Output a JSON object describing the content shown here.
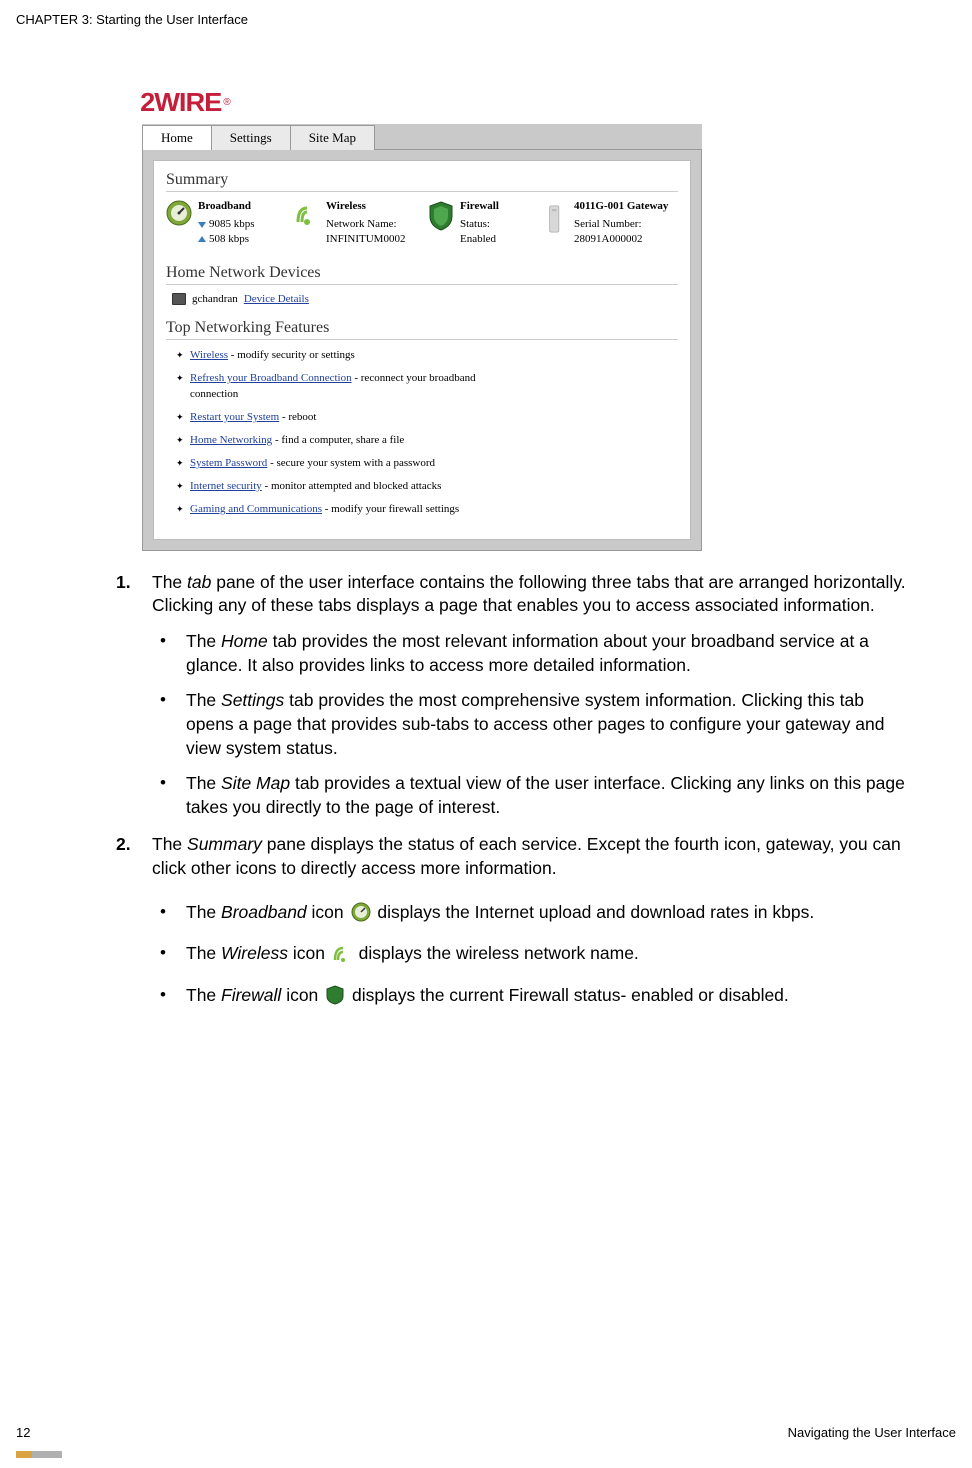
{
  "chapter": "CHAPTER 3: Starting the User Interface",
  "screenshot": {
    "logo": "2WIRE",
    "logo_reg": "®",
    "tabs": [
      "Home",
      "Settings",
      "Site Map"
    ],
    "summary_title": "Summary",
    "broadband": {
      "label": "Broadband",
      "down": "9085 kbps",
      "up": "508 kbps"
    },
    "wireless": {
      "label": "Wireless",
      "nn_label": "Network Name:",
      "nn_value": "INFINITUM0002"
    },
    "firewall": {
      "label": "Firewall",
      "status_label": "Status:",
      "status_value": "Enabled"
    },
    "gateway": {
      "label": "4011G-001 Gateway",
      "sn_label": "Serial Number:",
      "sn_value": "28091A000002"
    },
    "home_devices_title": "Home Network Devices",
    "device_name": "gchandran",
    "device_details": "Device Details",
    "top_features_title": "Top Networking Features",
    "features": [
      {
        "link": "Wireless",
        "rest": " - modify security or settings"
      },
      {
        "link": "Refresh your Broadband Connection",
        "rest": " - reconnect your broadband connection"
      },
      {
        "link": "Restart your System",
        "rest": " - reboot"
      },
      {
        "link": "Home Networking",
        "rest": " - find a computer, share a file"
      },
      {
        "link": "System Password",
        "rest": " - secure your system with a password"
      },
      {
        "link": "Internet security",
        "rest": " - monitor attempted and blocked attacks"
      },
      {
        "link": "Gaming and Communications",
        "rest": " - modify your firewall settings"
      }
    ]
  },
  "body": {
    "item1_intro": "The ",
    "item1_tab_word": "tab",
    "item1_rest": " pane of the user interface contains the following three tabs that are arranged horizontally. Clicking any of these tabs displays a page that enables you to access associated information.",
    "bullets1": [
      {
        "pre": "The ",
        "it": "Home",
        "post": " tab provides the most relevant information about your broadband service at a glance. It also provides links to access more detailed information."
      },
      {
        "pre": "The ",
        "it": "Settings",
        "post": " tab provides the most comprehensive system information. Clicking this tab opens a page that provides sub-tabs to access other pages to configure your gateway and view system status."
      },
      {
        "pre": "The ",
        "it": "Site Map",
        "post": " tab provides a textual view of the user interface. Clicking any links on this page takes you directly to the page of interest."
      }
    ],
    "item2_intro": "The ",
    "item2_summary_word": "Summary",
    "item2_rest": " pane displays the status of each service. Except the fourth icon, gateway, you can click other icons to directly access more information.",
    "bullets2": [
      {
        "pre": "The ",
        "it": "Broadband",
        "mid": " icon ",
        "post": " displays the Internet upload and download rates in kbps."
      },
      {
        "pre": "The ",
        "it": "Wireless",
        "mid": " icon ",
        "post": " displays the wireless network name."
      },
      {
        "pre": "The ",
        "it": "Firewall",
        "mid": " icon ",
        "post": " displays the current Firewall status- enabled or disabled."
      }
    ]
  },
  "footer": {
    "page": "12",
    "title": "Navigating the User Interface"
  }
}
